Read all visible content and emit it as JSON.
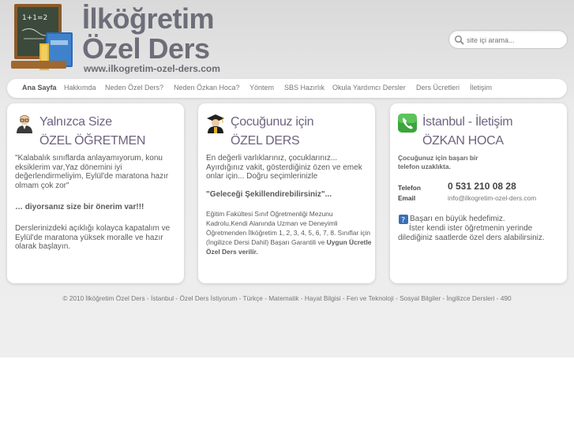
{
  "header": {
    "logo_line1": "İlköğretim",
    "logo_line2": "Özel Ders",
    "logo_url": "www.ilkogretim-ozel-ders.com",
    "chalkboard_text": "1+1=2",
    "search_placeholder": "site içi arama..."
  },
  "nav": {
    "items": [
      {
        "label": "Ana Sayfa",
        "active": true
      },
      {
        "label": "Hakkımda"
      },
      {
        "label": "Neden Özel Ders?"
      },
      {
        "label": "Neden Özkan Hoca?"
      },
      {
        "label": "Yöntem"
      },
      {
        "label": "SBS Hazırlık"
      },
      {
        "label": "Okula Yardımcı Dersler"
      },
      {
        "label": "Ders Ücretleri"
      },
      {
        "label": "İletişim"
      }
    ]
  },
  "box1": {
    "icon": "teacher-icon",
    "title1": "Yalnızca Size",
    "title2": "ÖZEL ÖĞRETMEN",
    "para1": "\"Kalabalık sınıflarda anlayamıyorum, konu eksiklerim var,Yaz dönemini iyi değerlendirmeliyim, Eylül'de maratona hazır olmam çok zor\"",
    "para2": "… diyorsanız size bir önerim var!!!",
    "para3": "Derslerinizdeki açıklığı kolayca kapatalım ve Eylül'de maratona yüksek moralle ve hazır olarak başlayın."
  },
  "box2": {
    "icon": "graduate-icon",
    "title1": "Çocuğunuz için",
    "title2": "ÖZEL DERS",
    "para1": "En değerli varlıklarınız, çocuklarınız... Ayırdığınız vakit, gösterdiğiniz özen ve emek onlar için... Doğru seçimlerinizle",
    "para1_quote": "\"Geleceği Şekillendirebilirsiniz\"...",
    "para2": "Eğitim Fakültesi Sınıf Öğretmenliği Mezunu Kadrolu,Kendi Alanında Uzman ve Deneyimli Öğretmenden İlköğretim 1, 2, 3, 4, 5, 6, 7, 8. Sınıflar için (İngilizce Dersi Dahil) Başarı Garantili ve",
    "para2_bold": "Uygun Ücretle Özel Ders verilir."
  },
  "box3": {
    "icon": "phone-icon",
    "title1": "İstanbul - İletişim",
    "title2": "ÖZKAN HOCA",
    "intro": "Çocuğunuz için başarı bir telefon uzaklıkta.",
    "phone_label": "Telefon",
    "phone_value": "0 531 210 08 28",
    "email_label": "Email",
    "email_value": "info@ilkogretim-ozel-ders.com",
    "help_icon": "question-icon",
    "closing1": "Başarı en büyük hedefimiz.",
    "closing2": "İster kendi ister öğretmenin yerinde dilediğiniz saatlerde özel ders alabilirsiniz."
  },
  "footer": {
    "text": "© 2010 İlköğretim Özel Ders - İstanbul - Özel Ders İstiyorum - Türkçe - Matematik - Hayat Bilgisi - Fen ve Teknoloji - Sosyal Bilgiler - İngilizce Dersleri - 490"
  }
}
